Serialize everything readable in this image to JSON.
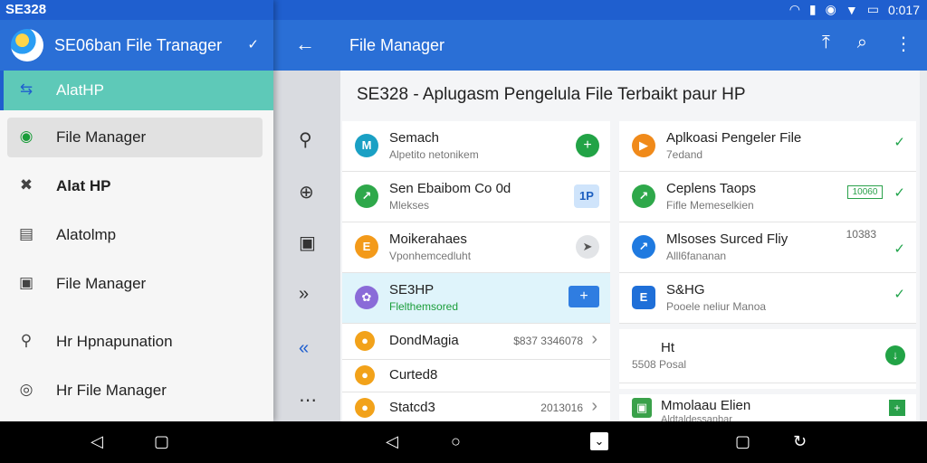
{
  "status_bar": {
    "title": "SE328",
    "time": "0:017"
  },
  "app_bar": {
    "title": "File Manager"
  },
  "drawer": {
    "app_name": "SE06ban File Tranager",
    "items": [
      {
        "label": "AlatHP",
        "icon": "alat-icon"
      },
      {
        "label": "File Manager",
        "icon": "chat-icon"
      },
      {
        "label": "Alat HP",
        "icon": "tools-icon"
      },
      {
        "label": "Alatolmp",
        "icon": "calendar-icon"
      },
      {
        "label": "File Manager",
        "icon": "folder-icon"
      },
      {
        "label": "Hr Hpnapunation",
        "icon": "search-icon"
      },
      {
        "label": "Hr File Manager",
        "icon": "location-icon"
      }
    ]
  },
  "main": {
    "heading": "SE328 - Aplugasm Pengelula File Terbaikt paur HP",
    "left_list": [
      {
        "title": "Semach",
        "subtitle": "Alpetito netonikem",
        "icon_text": "M",
        "icon_color": "#1aa0c4"
      },
      {
        "title": "Sen Ebaibom Co 0d",
        "subtitle": "Mlekses",
        "icon_text": "↗",
        "icon_color": "#2ea84a",
        "action_text": "1P"
      },
      {
        "title": "Moikerahaes",
        "subtitle": "Vponhemcedluht",
        "icon_text": "E",
        "icon_color": "#f39a1a"
      },
      {
        "title": "SE3HP",
        "subtitle": "Flelthemsored",
        "icon_text": "✿",
        "icon_color": "#8a6bd8"
      },
      {
        "title": "DondMagia",
        "subtitle": "",
        "icon_text": "●",
        "icon_color": "#f2a21a",
        "meta": "$837 3346078"
      },
      {
        "title": "Curted8",
        "subtitle": "",
        "icon_text": "●",
        "icon_color": "#f2a21a"
      },
      {
        "title": "Statcd3",
        "subtitle": "",
        "icon_text": "●",
        "icon_color": "#f2a21a",
        "meta": "2013016"
      }
    ],
    "right_list": [
      {
        "title": "Aplkoasi Pengeler File",
        "subtitle": "7edand",
        "icon_text": "▶",
        "icon_color": "#f08a1a"
      },
      {
        "title": "Ceplens Taops",
        "subtitle": "Fifle Memeselkien",
        "icon_text": "↗",
        "icon_color": "#2ea84a",
        "tag": "10060"
      },
      {
        "title": "Mlsoses Surced Fliy",
        "subtitle": "Alll6fananan",
        "icon_text": "↗",
        "icon_color": "#1f7ae0",
        "meta": "10383"
      },
      {
        "title": "S&HG",
        "subtitle": "Pooele neliur Manoa",
        "icon_text": "E",
        "icon_color": "#1f6fd8"
      },
      {
        "title": "Ht",
        "subtitle": "5508 Posal",
        "icon_text": "",
        "icon_color": "#ffffff"
      },
      {
        "title": "Mmolaau Elien",
        "subtitle": "Aldtaldessanbar",
        "icon_text": "▣",
        "icon_color": "#3aa14a"
      }
    ]
  }
}
